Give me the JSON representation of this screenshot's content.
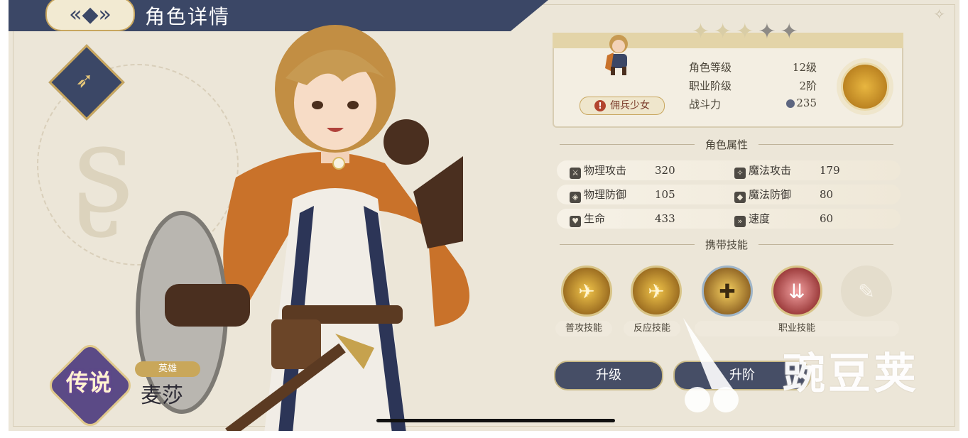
{
  "header": {
    "title": "角色详情",
    "back_icon": "back-arrow-icon"
  },
  "hero": {
    "rarity": "传说",
    "type_tag": "英雄",
    "name": "麦莎",
    "stars_filled": 3,
    "stars_total": 5
  },
  "profile": {
    "role_badge": "佣兵少女",
    "level_label": "角色等级",
    "level_value": "12级",
    "class_label": "职业阶级",
    "class_value": "2阶",
    "power_label": "战斗力",
    "power_value": "235"
  },
  "attributes": {
    "title": "角色属性",
    "items": [
      {
        "label": "物理攻击",
        "value": "320",
        "icon": "sword-icon"
      },
      {
        "label": "魔法攻击",
        "value": "179",
        "icon": "wand-icon"
      },
      {
        "label": "物理防御",
        "value": "105",
        "icon": "shield-icon"
      },
      {
        "label": "魔法防御",
        "value": "80",
        "icon": "magic-shield-icon"
      },
      {
        "label": "生命",
        "value": "433",
        "icon": "heart-icon"
      },
      {
        "label": "速度",
        "value": "60",
        "icon": "boot-icon"
      }
    ]
  },
  "skills": {
    "title": "携带技能",
    "labels": {
      "basic": "普攻技能",
      "counter": "反应技能",
      "class": "职业技能"
    }
  },
  "buttons": {
    "upgrade": "升级",
    "second": "升阶"
  },
  "watermark": "豌豆荚",
  "colors": {
    "navy": "#3b4766",
    "gold": "#c8a65e",
    "parchment": "#ece6d8"
  }
}
